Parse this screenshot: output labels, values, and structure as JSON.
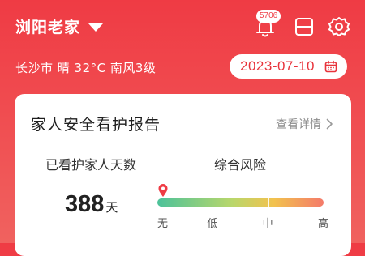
{
  "header": {
    "location": "浏阳老家",
    "notification_count": "5706"
  },
  "weather": {
    "text": "长沙市 晴 32°C 南风3级"
  },
  "date": {
    "value": "2023-07-10"
  },
  "report_card": {
    "title": "家人安全看护报告",
    "details_link": "查看详情",
    "days_label": "已看护家人天数",
    "days_value": "388",
    "days_unit": "天",
    "risk_label": "综合风险",
    "risk_levels": [
      "无",
      "低",
      "中",
      "高"
    ],
    "risk_current_fraction": 0.0
  },
  "colors": {
    "brand_red": "#ef3b44",
    "risk_low": "#4cc29a",
    "risk_mid": "#f2c24e",
    "risk_high": "#f47a6a"
  },
  "icons": [
    "chevron-down-icon",
    "bell-icon",
    "card-icon",
    "gear-icon",
    "calendar-icon",
    "chevron-right-icon",
    "location-pin-icon"
  ]
}
